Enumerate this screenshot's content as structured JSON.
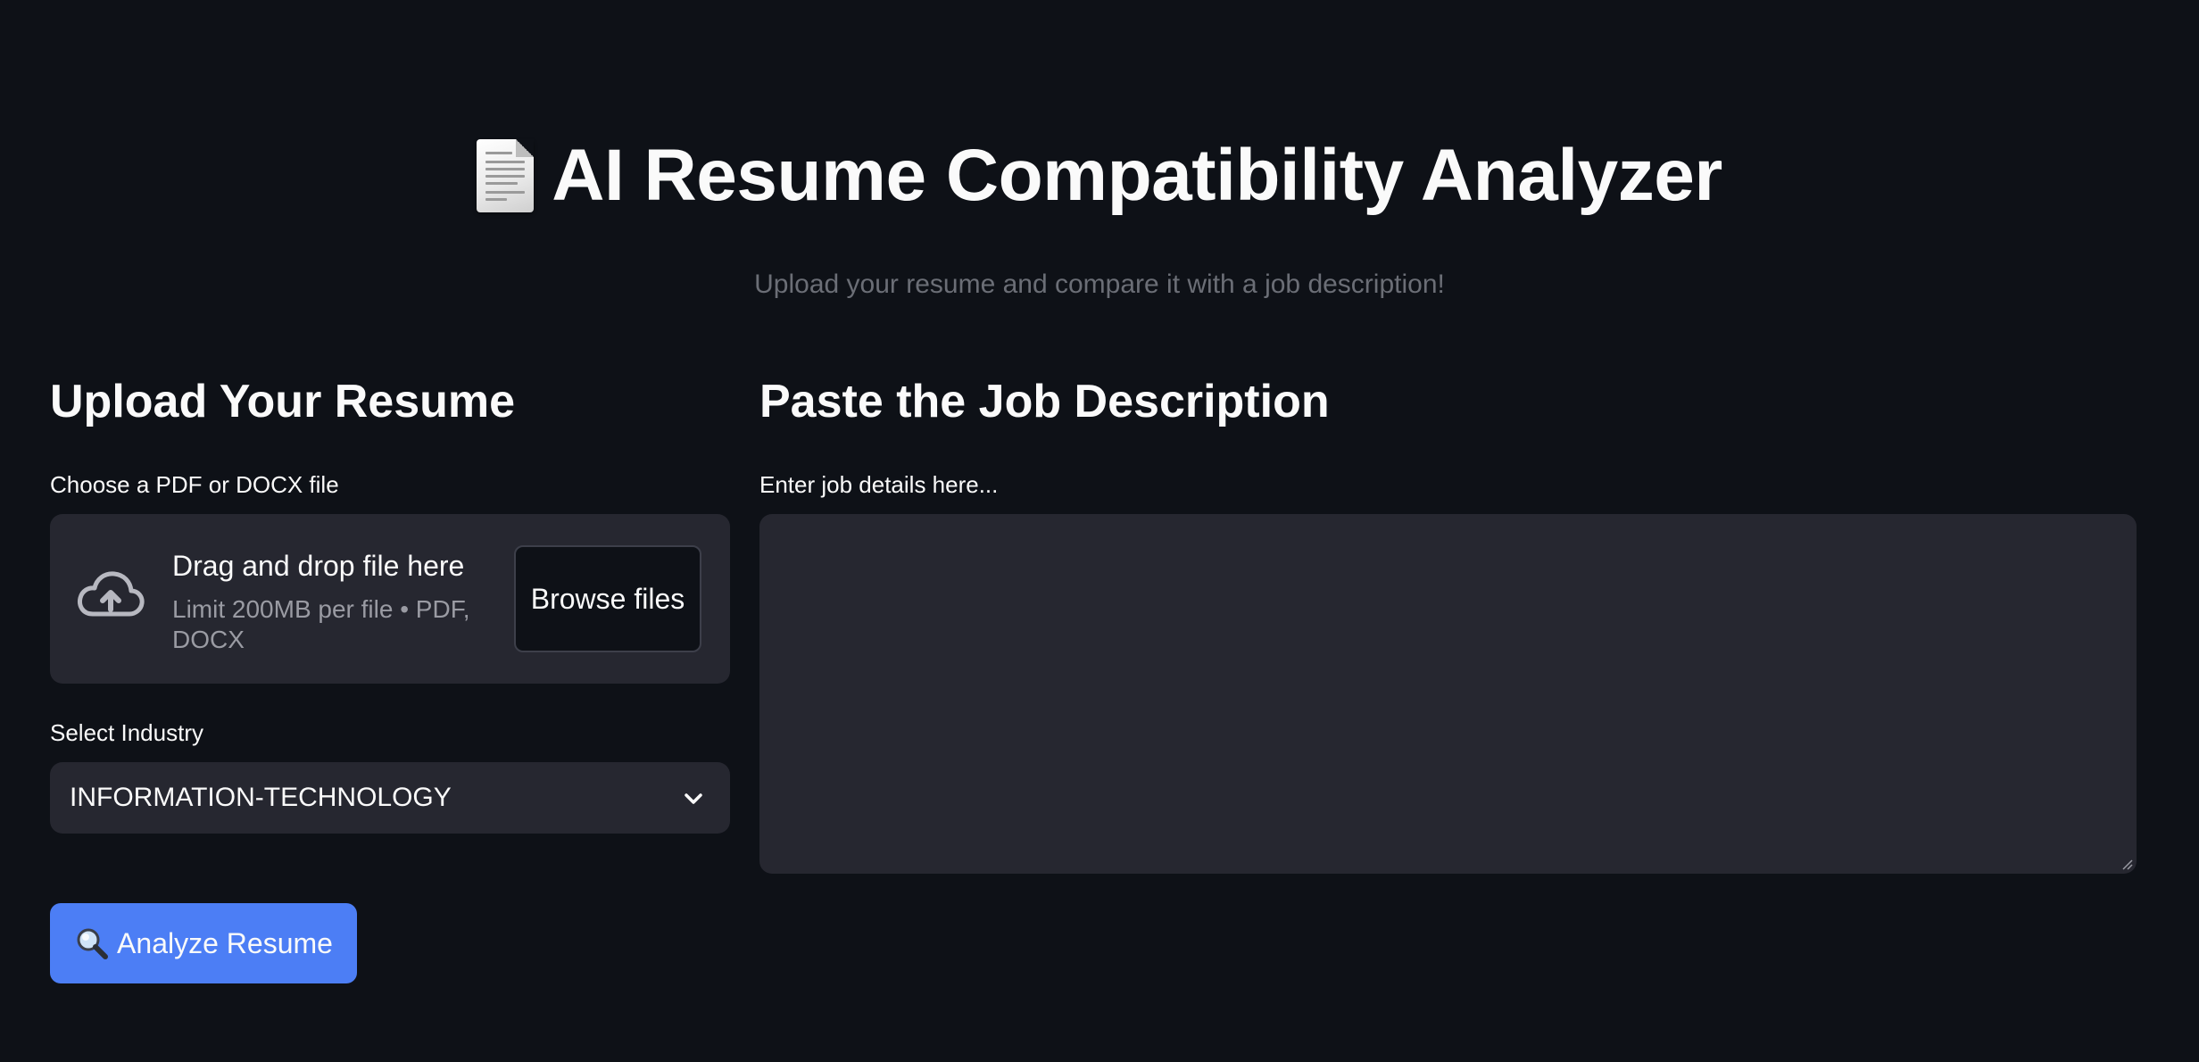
{
  "header": {
    "title": "AI Resume Compatibility Analyzer",
    "title_icon": "document-icon",
    "subtitle": "Upload your resume and compare it with a job description!"
  },
  "left_column": {
    "heading": "Upload Your Resume",
    "file_label": "Choose a PDF or DOCX file",
    "uploader": {
      "icon": "cloud-upload-icon",
      "drop_text": "Drag and drop file here",
      "limit_text": "Limit 200MB per file • PDF, DOCX",
      "browse_label": "Browse files"
    },
    "industry_label": "Select Industry",
    "industry_selected": "INFORMATION-TECHNOLOGY",
    "analyze_label": "Analyze Resume",
    "analyze_icon": "magnifier-icon"
  },
  "right_column": {
    "heading": "Paste the Job Description",
    "textarea_label": "Enter job details here...",
    "textarea_value": ""
  },
  "colors": {
    "background": "#0e1117",
    "panel": "#262730",
    "accent": "#4c7ef5",
    "muted_text": "#6b6e76"
  }
}
